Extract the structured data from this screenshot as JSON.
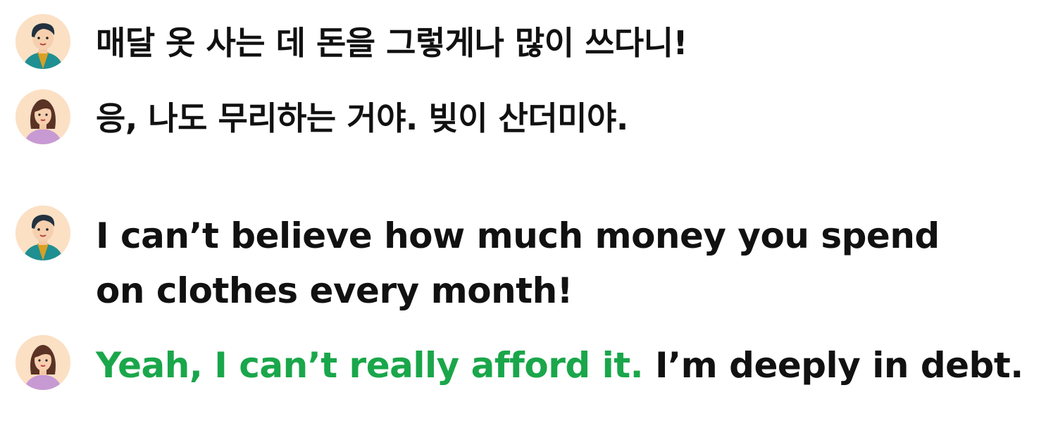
{
  "speakers": {
    "male": {
      "icon": "man-avatar-icon"
    },
    "female": {
      "icon": "woman-avatar-icon"
    }
  },
  "colors": {
    "highlight": "#1aa64a",
    "text": "#111111",
    "avatar_bg": "#fbe0c4"
  },
  "korean": {
    "line1": "매달 옷 사는 데 돈을 그렇게나 많이 쓰다니!",
    "line2": "응, 나도 무리하는 거야. 빚이 산더미야."
  },
  "english": {
    "line1_row1": "I can’t believe how much money you spend",
    "line1_row2": "on clothes every month!",
    "line2_highlight": "Yeah, I can’t really afford it.",
    "line2_rest": " I’m deeply in debt."
  }
}
